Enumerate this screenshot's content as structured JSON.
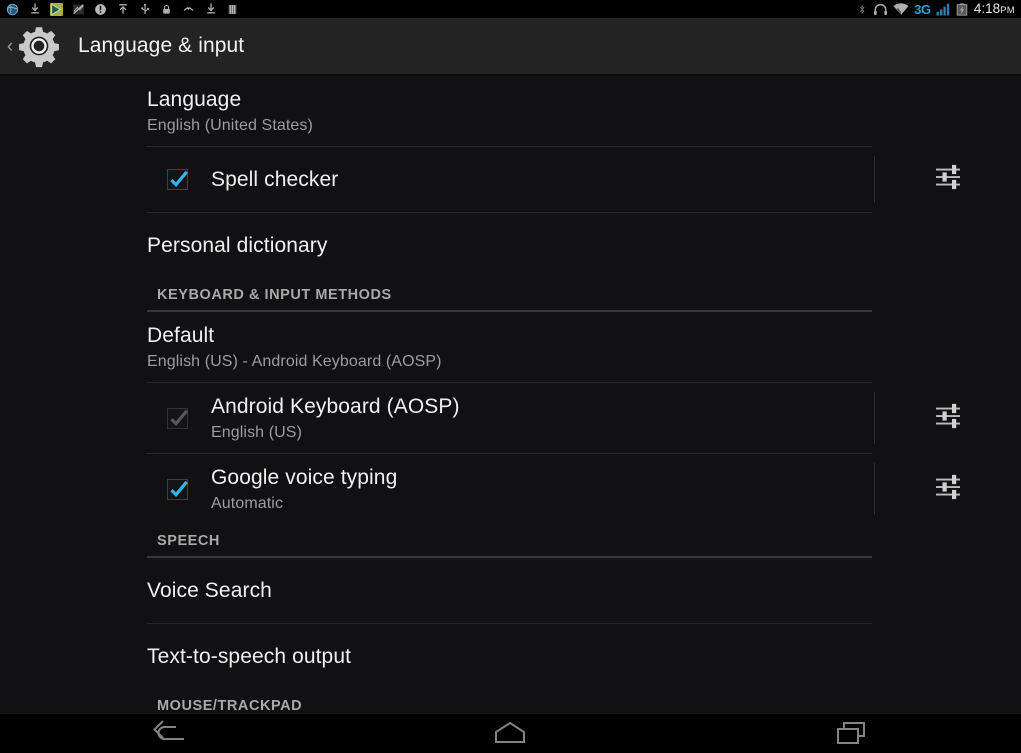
{
  "status_bar": {
    "left_icons": [
      "browser-globe-icon",
      "download-icon",
      "play-store-icon",
      "sync-problem-icon",
      "alert-circle-icon",
      "upload-icon",
      "usb-icon",
      "lock-icon",
      "missed-call-icon",
      "download-complete-icon",
      "sim-card-icon"
    ],
    "right_icons": [
      "bluetooth-icon",
      "headset-icon",
      "wifi-icon"
    ],
    "network_type": "3G",
    "signal_icon": "cellular-signal-icon",
    "battery_icon": "battery-icon",
    "clock_time": "4:18",
    "clock_ampm": "PM"
  },
  "action_bar": {
    "back_chevron": "‹",
    "app_icon": "settings-gear-icon",
    "title": "Language & input"
  },
  "colors": {
    "accent_blue": "#33b5e5",
    "network_blue": "#2e9fd4",
    "background": "#111113",
    "action_bar": "#232323",
    "primary_text": "#f0f0f0",
    "secondary_text": "#9d9d9d",
    "section_text": "#a9a9a9",
    "divider": "#2a2a2c"
  },
  "list": [
    {
      "kind": "item",
      "name": "language",
      "title": "Language",
      "subtitle": "English (United States)",
      "checkbox": null,
      "settings_button": false
    },
    {
      "kind": "divider"
    },
    {
      "kind": "item",
      "name": "spell-checker",
      "title": "Spell checker",
      "subtitle": "",
      "checkbox": "checked",
      "settings_button": true
    },
    {
      "kind": "divider"
    },
    {
      "kind": "item",
      "name": "personal-dictionary",
      "title": "Personal dictionary",
      "subtitle": "",
      "checkbox": null,
      "settings_button": false
    },
    {
      "kind": "section",
      "name": "keyboard-and-input-methods",
      "label": "KEYBOARD & INPUT METHODS"
    },
    {
      "kind": "item",
      "name": "default-keyboard",
      "title": "Default",
      "subtitle": "English (US) - Android Keyboard (AOSP)",
      "checkbox": null,
      "settings_button": false
    },
    {
      "kind": "divider"
    },
    {
      "kind": "item",
      "name": "android-keyboard-aosp",
      "title": "Android Keyboard (AOSP)",
      "subtitle": "English (US)",
      "checkbox": "checked-disabled",
      "settings_button": true
    },
    {
      "kind": "divider"
    },
    {
      "kind": "item",
      "name": "google-voice-typing",
      "title": "Google voice typing",
      "subtitle": "Automatic",
      "checkbox": "checked",
      "settings_button": true
    },
    {
      "kind": "section",
      "name": "speech",
      "label": "SPEECH"
    },
    {
      "kind": "item",
      "name": "voice-search",
      "title": "Voice Search",
      "subtitle": "",
      "checkbox": null,
      "settings_button": false
    },
    {
      "kind": "divider"
    },
    {
      "kind": "item",
      "name": "text-to-speech-output",
      "title": "Text-to-speech output",
      "subtitle": "",
      "checkbox": null,
      "settings_button": false
    },
    {
      "kind": "section",
      "name": "mouse-trackpad",
      "label": "MOUSE/TRACKPAD"
    }
  ],
  "nav_bar": {
    "buttons": [
      {
        "name": "back-button",
        "icon": "back-arrow-icon"
      },
      {
        "name": "home-button",
        "icon": "home-icon"
      },
      {
        "name": "recents-button",
        "icon": "recents-icon"
      }
    ]
  }
}
